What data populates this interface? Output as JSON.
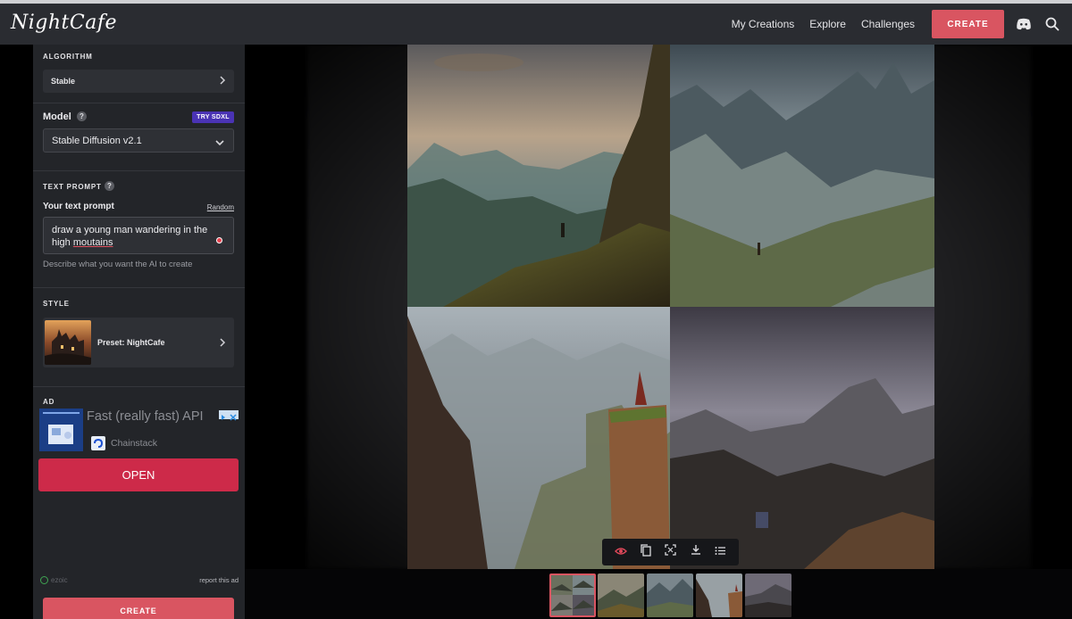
{
  "app": {
    "logo": "NightCafe"
  },
  "nav": {
    "links": [
      "My Creations",
      "Explore",
      "Challenges"
    ],
    "create_label": "CREATE",
    "icons": [
      "discord-icon",
      "search-icon"
    ]
  },
  "sidebar": {
    "algorithm": {
      "label": "ALGORITHM",
      "value": "Stable"
    },
    "model": {
      "label": "Model",
      "badge": "TRY SDXL",
      "value": "Stable Diffusion v2.1"
    },
    "text_prompt": {
      "label": "TEXT PROMPT",
      "sub_label": "Your text prompt",
      "random_label": "Random",
      "value_part1": "draw a young man wandering in the high ",
      "value_misspelled": "moutains",
      "helper": "Describe what you want the AI to create"
    },
    "style": {
      "label": "STYLE",
      "preset": "Preset: NightCafe"
    },
    "ad": {
      "label": "AD",
      "title": "Fast (really fast) API",
      "brand": "Chainstack",
      "open_label": "OPEN",
      "ezoic": "ezoic",
      "report": "report this ad"
    },
    "create_label": "CREATE"
  },
  "colors": {
    "accent": "#d95561",
    "ad_button": "#cd2a49",
    "badge": "#4a33b4",
    "panel": "#232529",
    "navbar": "#2a2c31"
  }
}
